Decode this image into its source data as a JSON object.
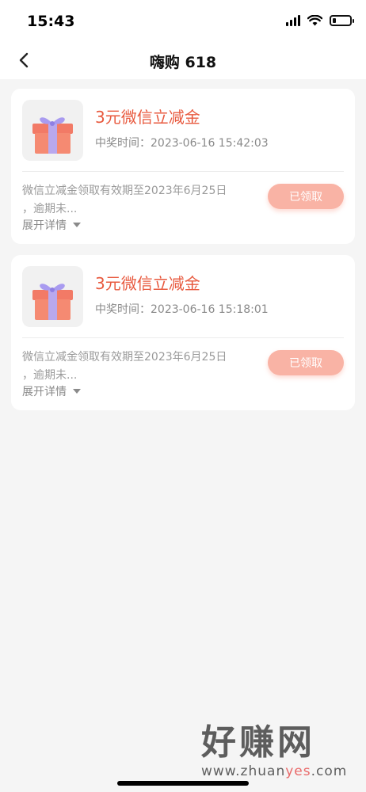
{
  "status_bar": {
    "time": "15:43",
    "battery_level": 0.2
  },
  "nav": {
    "title": "嗨购 618"
  },
  "prizes": [
    {
      "title": "3元微信立减金",
      "time": "中奖时间：2023-06-16 15:42:03",
      "desc_line1": "微信立减金领取有效期至2023年6月25日",
      "desc_line2": "，逾期未...",
      "expand_label": "展开详情",
      "button_label": "已领取"
    },
    {
      "title": "3元微信立减金",
      "time": "中奖时间：2023-06-16 15:18:01",
      "desc_line1": "微信立减金领取有效期至2023年6月25日",
      "desc_line2": "，逾期未...",
      "expand_label": "展开详情",
      "button_label": "已领取"
    }
  ],
  "watermark": {
    "main": "好赚网",
    "sub_pre": "www.zhuan",
    "sub_accent": "yes",
    "sub_post": ".com"
  },
  "colors": {
    "accent": "#e85a3f",
    "claimed_button": "#f9b3a5"
  }
}
